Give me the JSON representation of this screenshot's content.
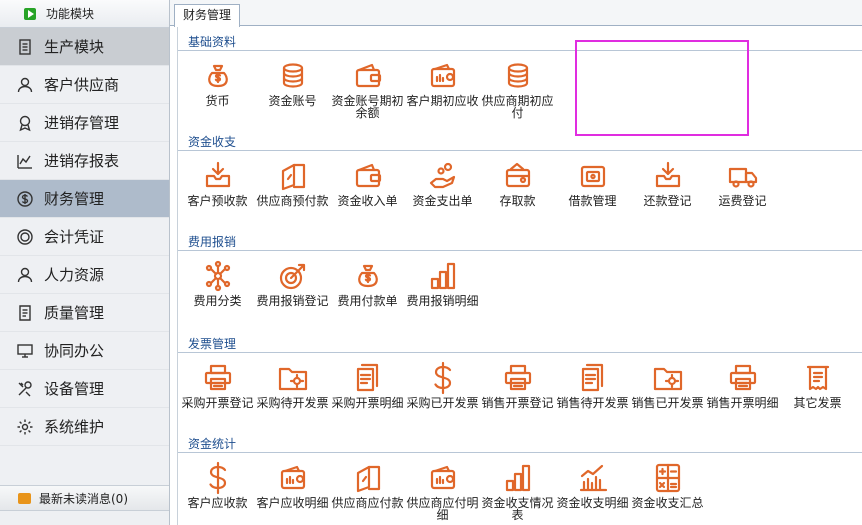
{
  "sidebar": {
    "header": "功能模块",
    "items": [
      {
        "label": "生产模块",
        "icon": "list-icon"
      },
      {
        "label": "客户供应商",
        "icon": "person-icon"
      },
      {
        "label": "进销存管理",
        "icon": "badge-icon"
      },
      {
        "label": "进销存报表",
        "icon": "chart-icon"
      },
      {
        "label": "财务管理",
        "icon": "money-icon"
      },
      {
        "label": "会计凭证",
        "icon": "coin-icon"
      },
      {
        "label": "人力资源",
        "icon": "person-icon"
      },
      {
        "label": "质量管理",
        "icon": "doc-icon"
      },
      {
        "label": "协同办公",
        "icon": "monitor-icon"
      },
      {
        "label": "设备管理",
        "icon": "tools-icon"
      },
      {
        "label": "系统维护",
        "icon": "gear-icon"
      }
    ],
    "footer": "最新未读消息(0)"
  },
  "tab": {
    "label": "财务管理"
  },
  "sections": [
    {
      "title": "基础资料",
      "items": [
        {
          "label": "货币",
          "icon": "moneybag-icon"
        },
        {
          "label": "资金账号",
          "icon": "coins-icon"
        },
        {
          "label": "资金账号期初余额",
          "icon": "wallet-icon"
        },
        {
          "label": "客户期初应收",
          "icon": "wallet-chart-icon"
        },
        {
          "label": "供应商期初应付",
          "icon": "coins-icon"
        }
      ]
    },
    {
      "title": "资金收支",
      "items": [
        {
          "label": "客户预收款",
          "icon": "inbox-icon"
        },
        {
          "label": "供应商预付款",
          "icon": "book-icon"
        },
        {
          "label": "资金收入单",
          "icon": "wallet-icon"
        },
        {
          "label": "资金支出单",
          "icon": "hand-coins-icon"
        },
        {
          "label": "存取款",
          "icon": "wallet-open-icon"
        },
        {
          "label": "借款管理",
          "icon": "purse-icon"
        },
        {
          "label": "还款登记",
          "icon": "inbox-icon"
        },
        {
          "label": "运费登记",
          "icon": "truck-icon"
        }
      ]
    },
    {
      "title": "费用报销",
      "items": [
        {
          "label": "费用分类",
          "icon": "molecule-icon"
        },
        {
          "label": "费用报销登记",
          "icon": "target-icon"
        },
        {
          "label": "费用付款单",
          "icon": "moneybag-icon"
        },
        {
          "label": "费用报销明细",
          "icon": "bar-chart-icon"
        }
      ]
    },
    {
      "title": "发票管理",
      "items": [
        {
          "label": "采购开票登记",
          "icon": "printer-icon"
        },
        {
          "label": "采购待开发票",
          "icon": "folder-gear-icon"
        },
        {
          "label": "采购开票明细",
          "icon": "documents-icon"
        },
        {
          "label": "采购已开发票",
          "icon": "dollar-icon"
        },
        {
          "label": "销售开票登记",
          "icon": "printer-icon"
        },
        {
          "label": "销售待开发票",
          "icon": "documents-icon"
        },
        {
          "label": "销售已开发票",
          "icon": "folder-gear-icon"
        },
        {
          "label": "销售开票明细",
          "icon": "printer-icon"
        },
        {
          "label": "其它发票",
          "icon": "receipt-icon"
        }
      ]
    },
    {
      "title": "资金统计",
      "items": [
        {
          "label": "客户应收款",
          "icon": "dollar-icon"
        },
        {
          "label": "客户应收明细",
          "icon": "wallet-chart-icon"
        },
        {
          "label": "供应商应付款",
          "icon": "book-icon"
        },
        {
          "label": "供应商应付明细",
          "icon": "wallet-chart-icon"
        },
        {
          "label": "资金收支情况表",
          "icon": "bar-chart-icon"
        },
        {
          "label": "资金收支明细",
          "icon": "line-chart-icon"
        },
        {
          "label": "资金收支汇总",
          "icon": "calculator-icon"
        }
      ]
    }
  ],
  "colors": {
    "icon": "#e0672a",
    "section_title": "#1f4f8f",
    "highlight": "#e02de0",
    "sidebar_active": "#aebbcb"
  }
}
